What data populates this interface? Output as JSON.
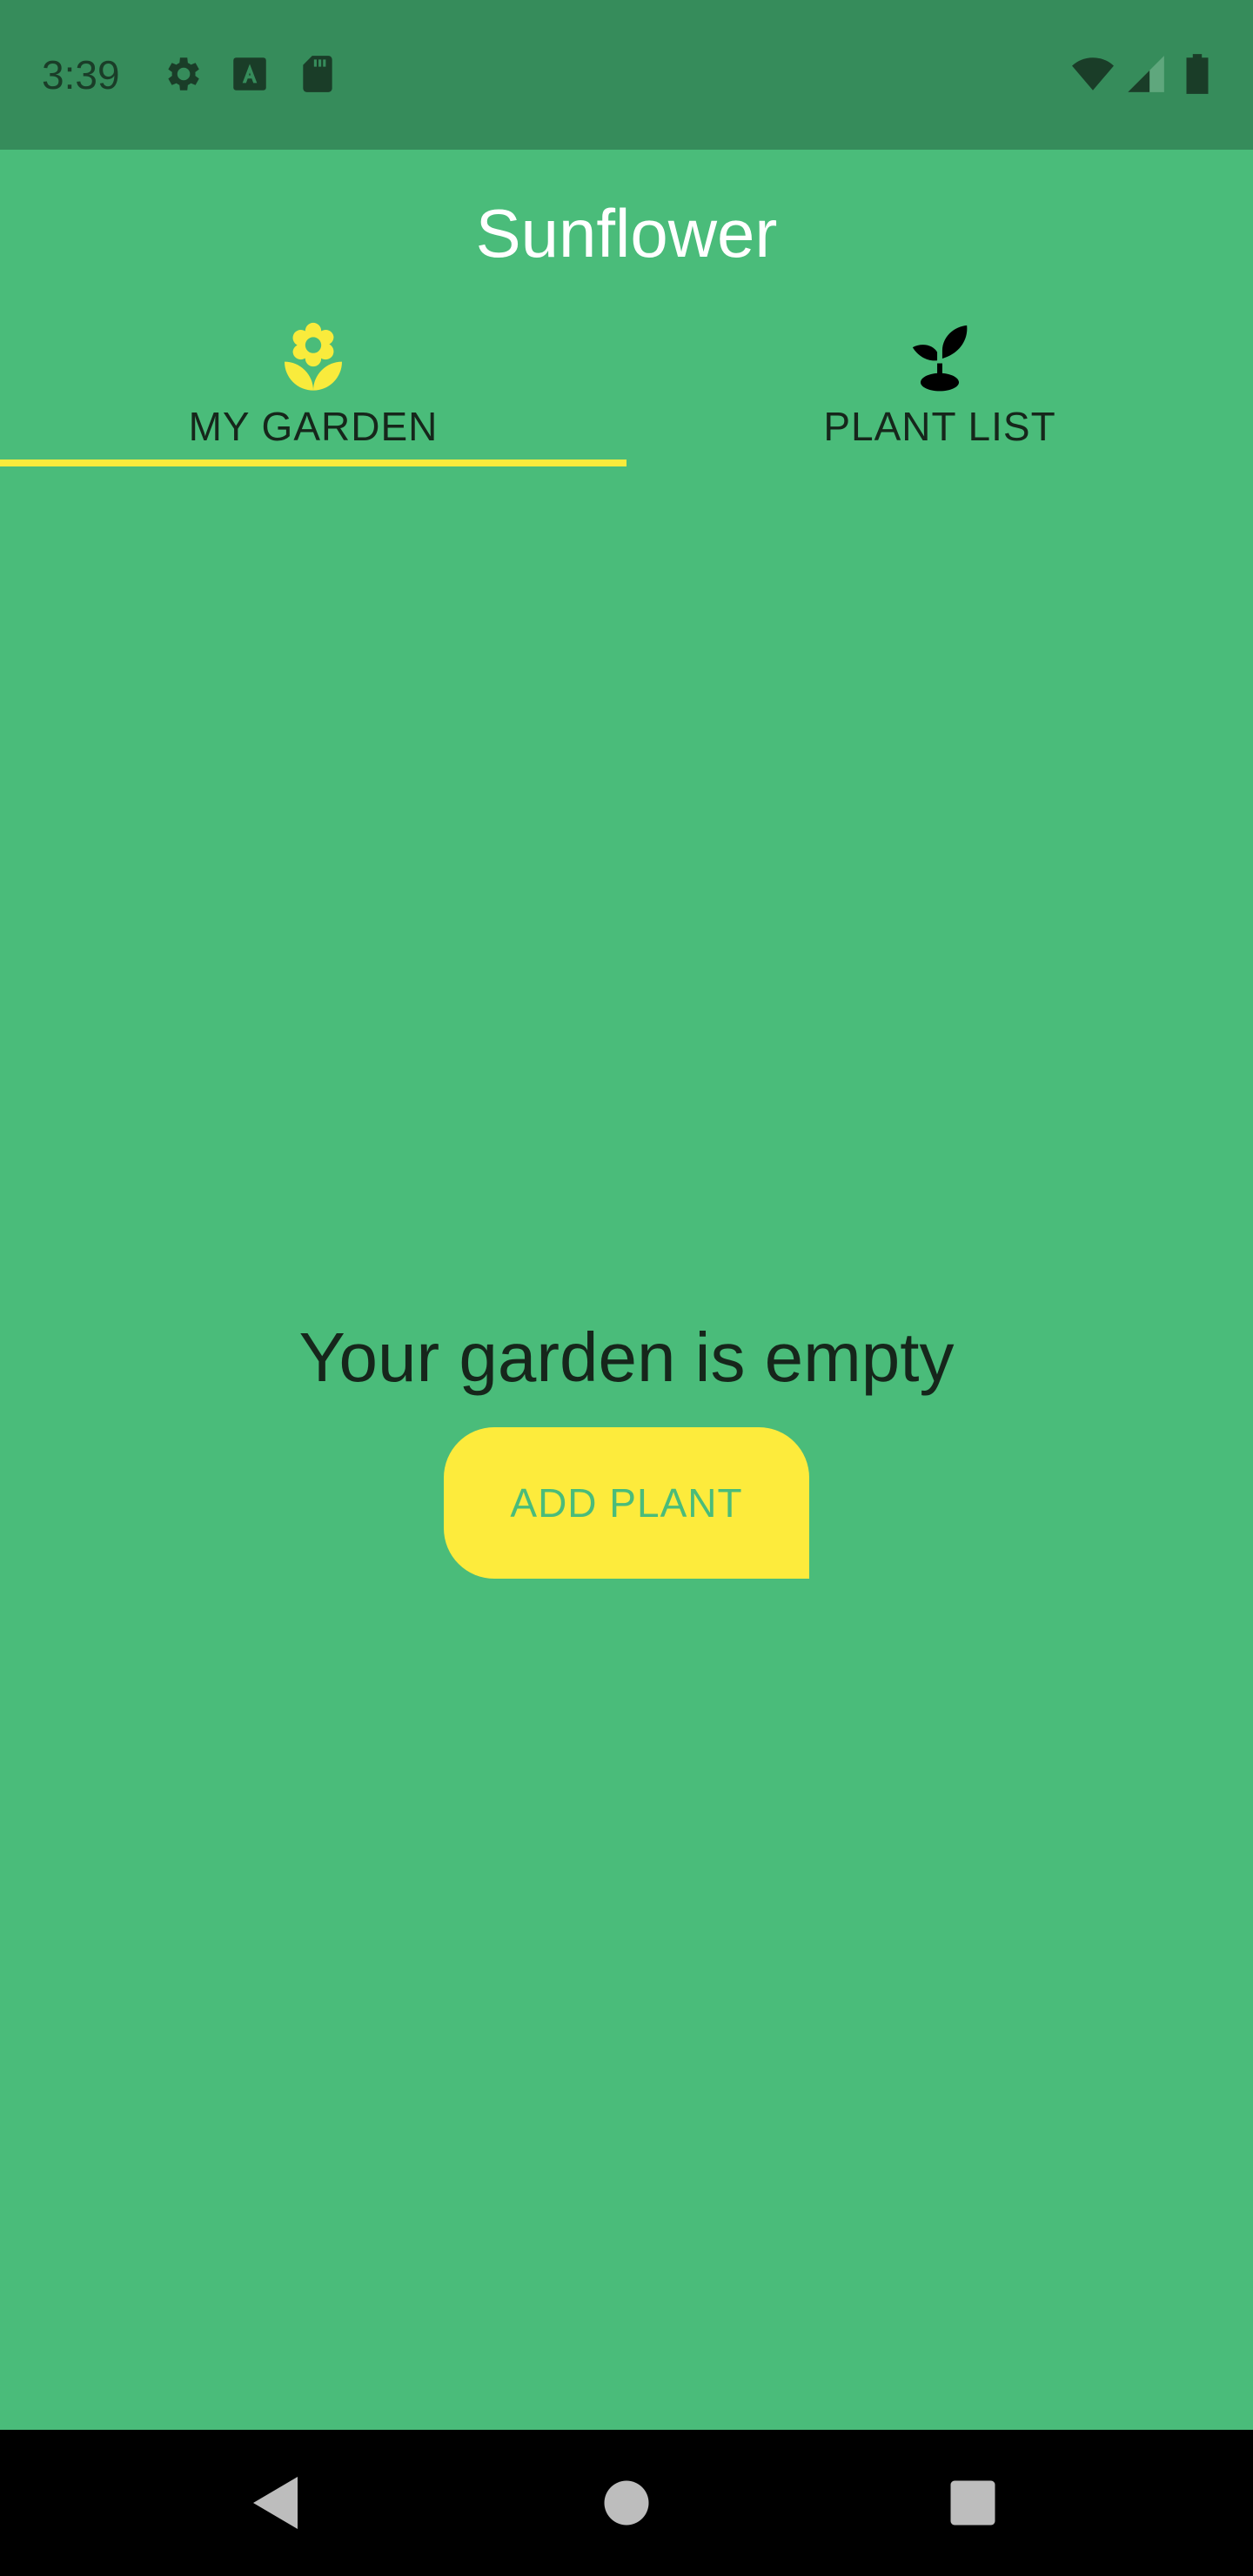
{
  "status_bar": {
    "time": "3:39",
    "icons": [
      "settings-icon",
      "text-recognition-icon",
      "sd-card-icon",
      "wifi-icon",
      "signal-icon",
      "battery-icon"
    ]
  },
  "app": {
    "title": "Sunflower"
  },
  "tabs": [
    {
      "label": "MY GARDEN",
      "icon": "flower-icon",
      "selected": true
    },
    {
      "label": "PLANT LIST",
      "icon": "sprout-icon",
      "selected": false
    }
  ],
  "garden": {
    "empty_message": "Your garden is empty",
    "add_button_label": "ADD PLANT"
  },
  "nav_bar": {
    "buttons": [
      "back-icon",
      "home-icon",
      "recents-icon"
    ]
  },
  "colors": {
    "background": "#4ABC7A",
    "status_bar": "#368C5B",
    "accent": "#F9EB3C",
    "text_dark": "#16261B",
    "nav_bar": "#000000"
  }
}
